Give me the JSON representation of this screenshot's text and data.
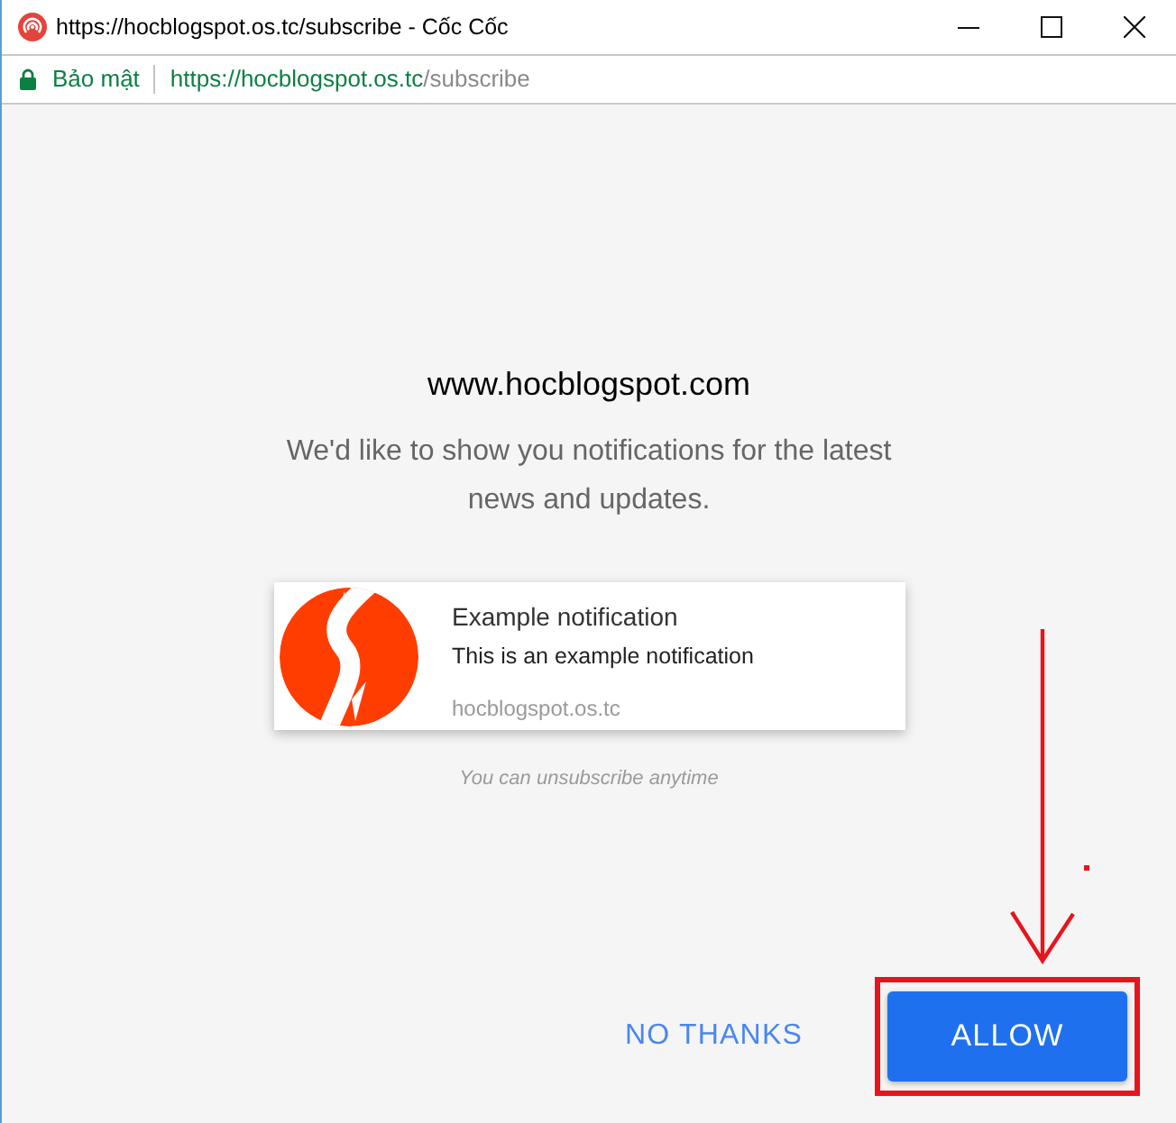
{
  "window": {
    "title": "https://hocblogspot.os.tc/subscribe - Cốc Cốc"
  },
  "address_bar": {
    "security_label": "Bảo mật",
    "url_host": "https://hocblogspot.os.tc",
    "url_path": "/subscribe"
  },
  "prompt": {
    "site": "www.hocblogspot.com",
    "message": "We'd like to show you notifications for the latest news and updates."
  },
  "notification": {
    "title": "Example notification",
    "body": "This is an example notification",
    "source": "hocblogspot.os.tc"
  },
  "note": "You can unsubscribe anytime",
  "buttons": [
    {
      "label": "NO THANKS",
      "kind": "text",
      "highlighted": false
    },
    {
      "label": "ALLOW",
      "kind": "filled",
      "highlighted": true
    }
  ]
}
